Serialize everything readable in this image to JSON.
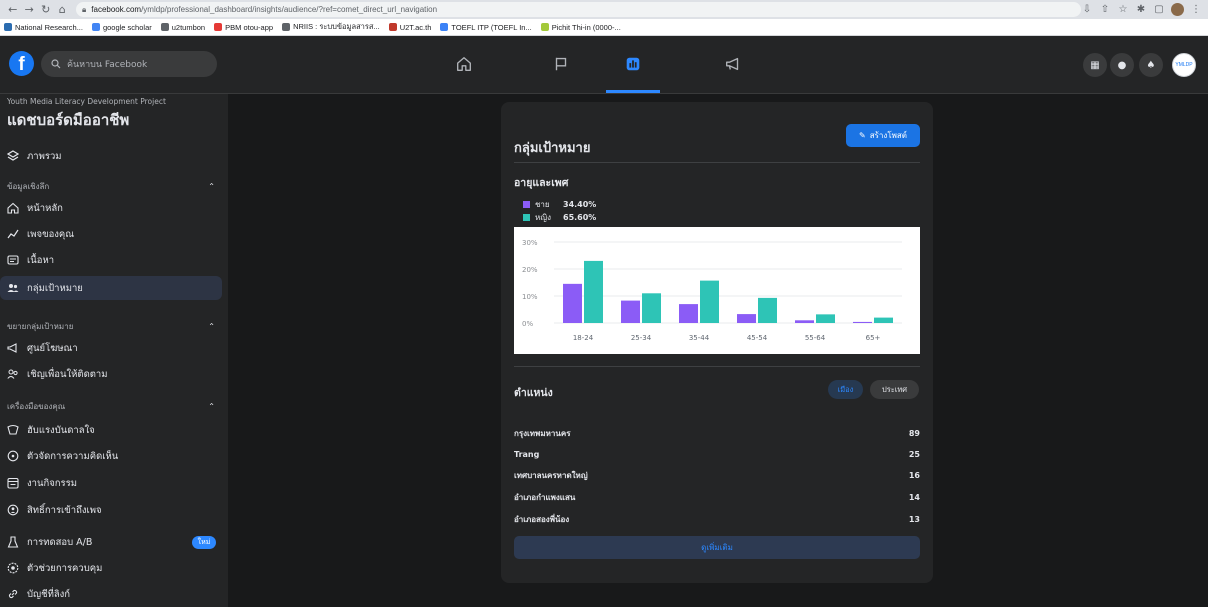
{
  "browser": {
    "url_domain": "facebook.com",
    "url_path": "/ymldp/professional_dashboard/insights/audience/?ref=comet_direct_url_navigation",
    "bookmarks": [
      {
        "label": "National Research...",
        "color": "#2b6cb0"
      },
      {
        "label": "google scholar",
        "color": "#4285f4"
      },
      {
        "label": "u2tumbon",
        "color": "#5f6368"
      },
      {
        "label": "PBM otou-app",
        "color": "#e53935"
      },
      {
        "label": "NRIIS : ระบบข้อมูลสารส...",
        "color": "#5f6368"
      },
      {
        "label": "U2T.ac.th",
        "color": "#c0392b"
      },
      {
        "label": "TOEFL ITP (TOEFL In...",
        "color": "#3b82f6"
      },
      {
        "label": "Pichit Thi-in (0000-...",
        "color": "#a3c93a"
      }
    ]
  },
  "topbar": {
    "logo": "f",
    "search_placeholder": "ค้นหาบน Facebook",
    "profile_text": "YMLDP"
  },
  "sidebar": {
    "project_name": "Youth Media Literacy Development Project",
    "dashboard_title": "แดชบอร์ดมืออาชีพ",
    "overview": "ภาพรวม",
    "section_insights": "ข้อมูลเชิงลึก",
    "home": "หน้าหลัก",
    "your_page": "เพจของคุณ",
    "content": "เนื้อหา",
    "audience": "กลุ่มเป้าหมาย",
    "section_expand": "ขยายกลุ่มเป้าหมาย",
    "ad_center": "ศูนย์โฆษณา",
    "invite_friends": "เชิญเพื่อนให้ติดตาม",
    "section_tools": "เครื่องมือของคุณ",
    "inspiration": "ฮับแรงบันดาลใจ",
    "comment_manager": "ตัวจัดการความคิดเห็น",
    "events": "งานกิจกรรม",
    "page_access": "สิทธิ์การเข้าถึงเพจ",
    "ab_test": "การทดสอบ A/B",
    "new_badge": "ใหม่",
    "moderation_assist": "ตัวช่วยการควบคุม",
    "linked_accounts": "บัญชีที่ลิงก์"
  },
  "card": {
    "title": "กลุ่มเป้าหมาย",
    "create_post": "สร้างโพสต์",
    "age_gender_title": "อายุและเพศ",
    "legend": [
      {
        "label": "ชาย",
        "value": "34.40%",
        "color": "#8b5cf6"
      },
      {
        "label": "หญิง",
        "value": "65.60%",
        "color": "#2ec4b6"
      }
    ],
    "location_title": "ตำแหน่ง",
    "toggle_city": "เมือง",
    "toggle_country": "ประเทศ",
    "locations": [
      {
        "name": "กรุงเทพมหานคร",
        "count": "89"
      },
      {
        "name": "Trang",
        "count": "25"
      },
      {
        "name": "เทศบาลนครหาดใหญ่",
        "count": "16"
      },
      {
        "name": "อำเภอกำแพงแสน",
        "count": "14"
      },
      {
        "name": "อำเภอสองพี่น้อง",
        "count": "13"
      }
    ],
    "see_more": "ดูเพิ่มเติม"
  },
  "chart_data": {
    "type": "bar",
    "categories": [
      "18-24",
      "25-34",
      "35-44",
      "45-54",
      "55-64",
      "65+"
    ],
    "series": [
      {
        "name": "ชาย",
        "values": [
          14.5,
          8.3,
          7.0,
          3.3,
          1.0,
          0.4
        ]
      },
      {
        "name": "หญิง",
        "values": [
          23.0,
          11.0,
          15.7,
          9.3,
          3.2,
          2.0
        ]
      }
    ],
    "y_ticks": [
      "0%",
      "10%",
      "20%",
      "30%"
    ],
    "ylim": [
      0,
      30
    ],
    "grid": true,
    "colors": [
      "#8b5cf6",
      "#2ec4b6"
    ]
  }
}
